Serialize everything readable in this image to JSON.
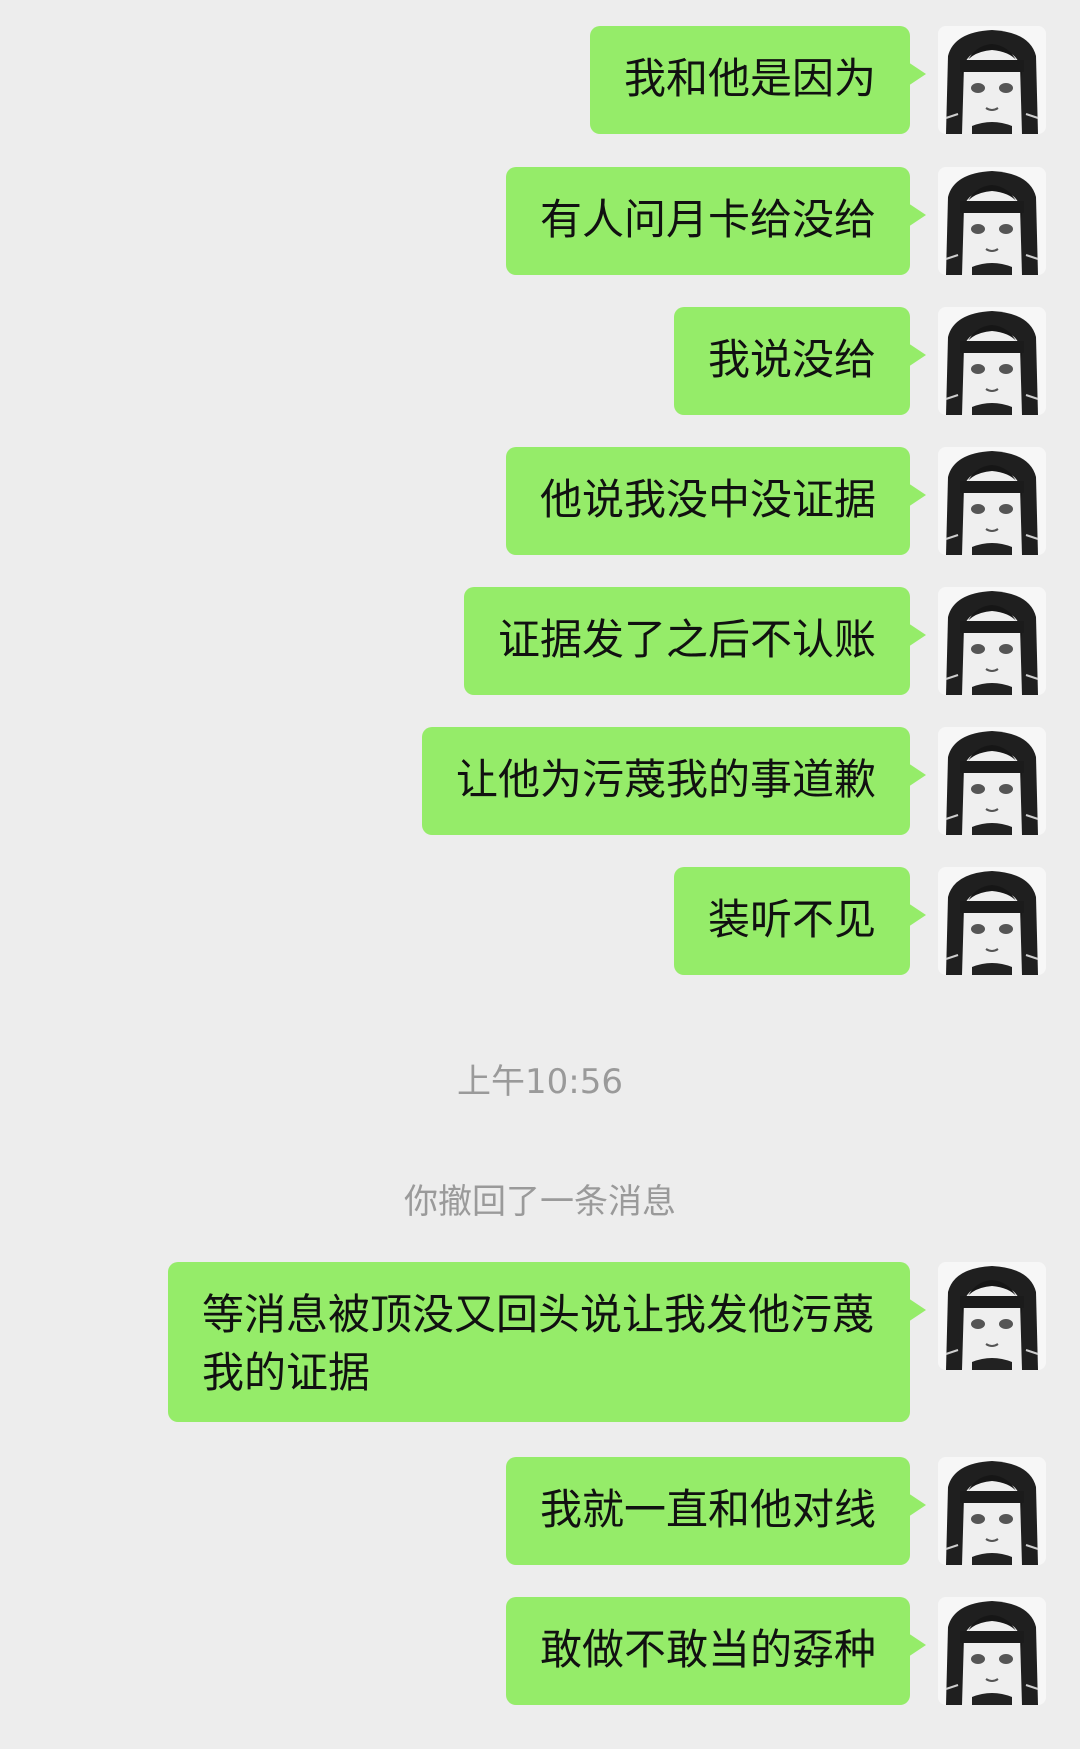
{
  "timestamp": "上午10:56",
  "recall_notice": "你撤回了一条消息",
  "avatar_icon": "anime-girl-avatar",
  "bubble_color": "#95ec69",
  "background_color": "#ededed",
  "messages_before": [
    {
      "text": "我和他是因为"
    },
    {
      "text": "有人问月卡给没给"
    },
    {
      "text": "我说没给"
    },
    {
      "text": "他说我没中没证据"
    },
    {
      "text": "证据发了之后不认账"
    },
    {
      "text": "让他为污蔑我的事道歉"
    },
    {
      "text": "装听不见"
    }
  ],
  "messages_after": [
    {
      "text": "等消息被顶没又回头说让我发他污蔑我的证据"
    },
    {
      "text": "我就一直和他对线"
    },
    {
      "text": "敢做不敢当的孬种"
    }
  ]
}
